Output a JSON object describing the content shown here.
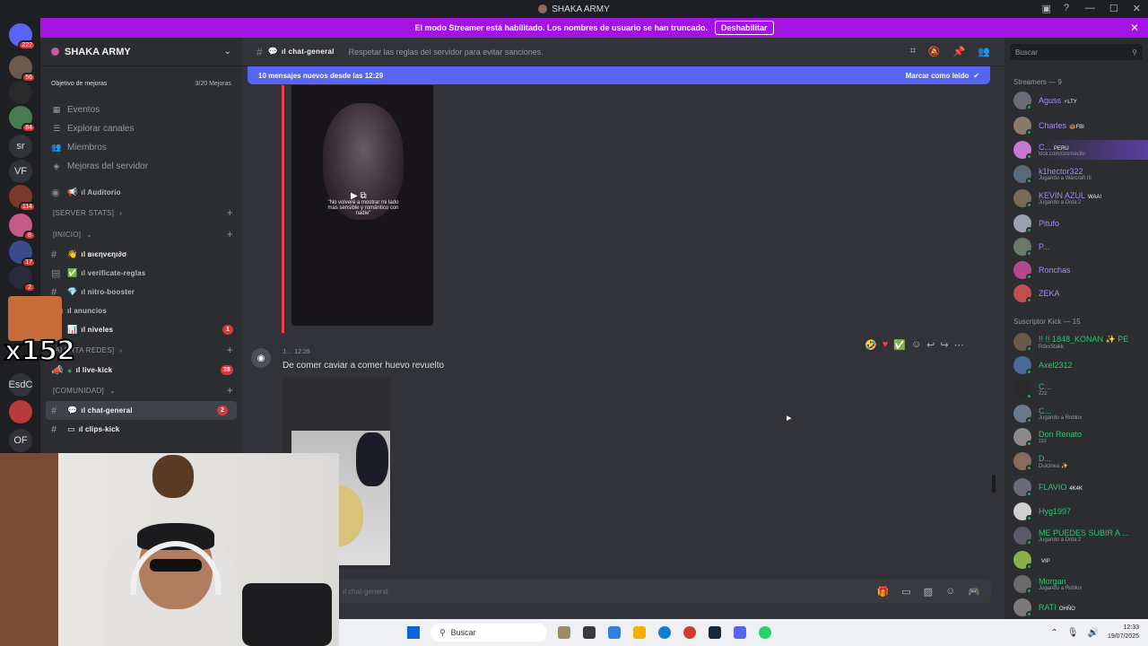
{
  "window": {
    "title": "SHAKA ARMY",
    "controls": [
      "—",
      "☐",
      "✕"
    ]
  },
  "banner": {
    "text": "El modo Streamer está habilitado. Los nombres de usuario se han truncado.",
    "button": "Deshabilitar"
  },
  "servers": [
    {
      "label": "",
      "badge": "222"
    },
    {
      "label": "",
      "badge": "56"
    },
    {
      "label": "",
      "badge": ""
    },
    {
      "label": "",
      "badge": "84"
    },
    {
      "label": "sr",
      "badge": ""
    },
    {
      "label": "VF",
      "badge": ""
    },
    {
      "label": "",
      "badge": "114"
    },
    {
      "label": "",
      "badge": "8"
    },
    {
      "label": "",
      "badge": "17"
    },
    {
      "label": "",
      "badge": "2"
    },
    {
      "label": "EsdC",
      "badge": ""
    },
    {
      "label": "",
      "badge": ""
    },
    {
      "label": "OF",
      "badge": ""
    }
  ],
  "guild": {
    "name": "SHAKA ARMY",
    "boost_goal": "Objetivo de mejoras",
    "boost_progress": "3/20 Mejoras"
  },
  "nav": [
    {
      "label": "Eventos",
      "icon": "calendar-icon",
      "glyph": "▦"
    },
    {
      "label": "Explorar canales",
      "icon": "browse-channels-icon",
      "glyph": "☰"
    },
    {
      "label": "Miembros",
      "icon": "members-icon",
      "glyph": "👥"
    },
    {
      "label": "Mejoras del servidor",
      "icon": "boost-icon",
      "glyph": "◈"
    }
  ],
  "channels": {
    "auditorio": "ıl Auditorio",
    "cat_stats": "[SERVER STATS]",
    "cat_inicio": "[INICIO]",
    "bienvenida": "ıl вιєηνєηι∂σ",
    "verificate": "ıl verificate-reglas",
    "nitro": "ıl nitro-booster",
    "anuncios": "ıl anuncios",
    "niveles": "ıl niveles",
    "niveles_count": "1",
    "cat_alerta": "[ALERTA REDES]",
    "livekick": "ıl live-kick",
    "livekick_count": "38",
    "cat_comunidad": "[COMUNIDAD]",
    "general": "ıl chat-general",
    "general_count": "2",
    "clips": "ıl clips-kick"
  },
  "topbar": {
    "channel": "ıl chat-general",
    "topic": "Respetar las reglas del servidor para evitar sanciones."
  },
  "newmsgs": {
    "text": "10 mensajes nuevos desde las 12:29",
    "mark": "Marcar como leído"
  },
  "media1": {
    "overlay": "\"No volveré a mostrar mi lado mas sensible y romántico con nadie\""
  },
  "message": {
    "author": "J...",
    "time": "12:26",
    "text": "De comer caviar a comer huevo revuelto"
  },
  "composer": {
    "placeholder": "ıl chat-general"
  },
  "members": {
    "search": "Buscar",
    "group1": "Streamers — 9",
    "group2": "Suscriptor Kick — 15",
    "streamers": [
      {
        "name": "Aguss",
        "tag": "⚡LTY",
        "sub": "",
        "color": "#a78bfa"
      },
      {
        "name": "Charles",
        "tag": "🍩FBI",
        "sub": "",
        "color": "#a78bfa"
      },
      {
        "name": "C...",
        "tag": "PERU",
        "sub": "kick.com/cosmecito",
        "color": "#a78bfa"
      },
      {
        "name": "k1hector322",
        "tag": "",
        "sub": "Jugando a Warcraft III",
        "color": "#a78bfa"
      },
      {
        "name": "KEVIN AZUL",
        "tag": "WAA!",
        "sub": "Jugando a Dota 2",
        "color": "#a78bfa"
      },
      {
        "name": "Pitufo",
        "tag": "",
        "sub": "",
        "color": "#a78bfa"
      },
      {
        "name": "P...",
        "tag": "",
        "sub": "",
        "color": "#a78bfa"
      },
      {
        "name": "Ronchas",
        "tag": "",
        "sub": "",
        "color": "#a78bfa"
      },
      {
        "name": "ZEKA",
        "tag": "",
        "sub": "",
        "color": "#a78bfa"
      }
    ],
    "subs": [
      {
        "name": "!! !! 1848_KONAN ✨ PE",
        "tag": "",
        "sub": "Rdxx5takk"
      },
      {
        "name": "Axel2312",
        "tag": "",
        "sub": ""
      },
      {
        "name": "C...",
        "tag": "",
        "sub": "Zzz"
      },
      {
        "name": "C...",
        "tag": "",
        "sub": "Jugando a Roblox"
      },
      {
        "name": "Don Renato",
        "tag": "",
        "sub": "zzz"
      },
      {
        "name": "D...",
        "tag": "",
        "sub": "Dulcinea ✨"
      },
      {
        "name": "FLAVIO",
        "tag": "4K4K",
        "sub": ""
      },
      {
        "name": "Hyg1997",
        "tag": "",
        "sub": ""
      },
      {
        "name": "ME PUEDES SUBIR A ...",
        "tag": "",
        "sub": "Jugando a Dota 2"
      },
      {
        "name": "",
        "tag": "VIP",
        "sub": ""
      },
      {
        "name": "Morgan",
        "tag": "",
        "sub": "Jugando a Roblox"
      },
      {
        "name": "RATI",
        "tag": "OHÑO",
        "sub": ""
      }
    ]
  },
  "overlay": {
    "text": "x152"
  },
  "taskbar": {
    "search": "Buscar",
    "time": "12:33",
    "date": "19/07/2025"
  },
  "colors": {
    "banner": "#a313e3",
    "accent": "#5865f2",
    "online": "#23a55a",
    "unread": "#da373c"
  }
}
